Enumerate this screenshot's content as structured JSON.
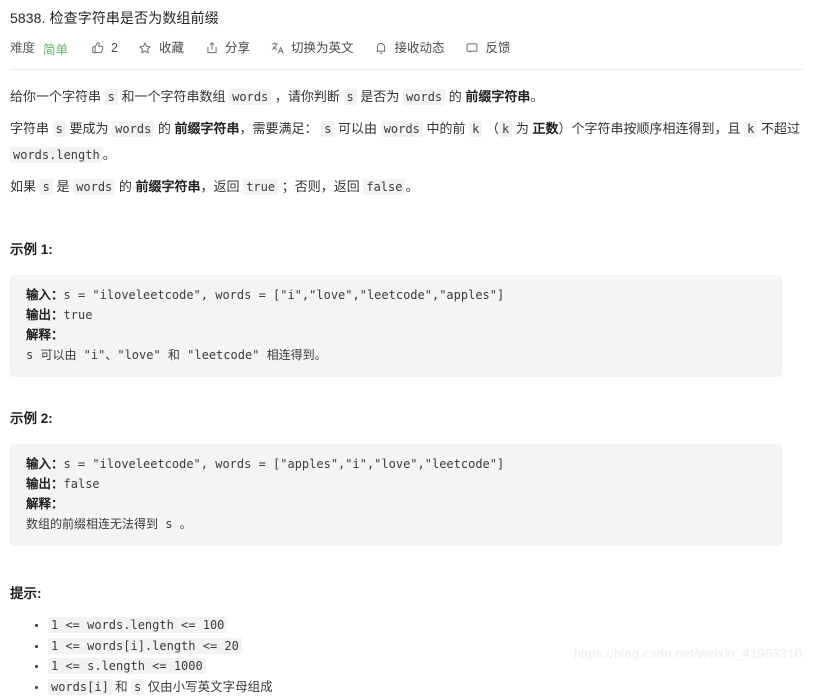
{
  "header": {
    "title": "5838. 检查字符串是否为数组前缀",
    "difficulty_label": "难度",
    "difficulty_value": "简单",
    "difficulty_color": "#5cb85c",
    "actions": [
      {
        "icon": "thumbs-up-icon",
        "label": "2"
      },
      {
        "icon": "star-icon",
        "label": "收藏"
      },
      {
        "icon": "share-icon",
        "label": "分享"
      },
      {
        "icon": "translate-icon",
        "label": "切换为英文"
      },
      {
        "icon": "bell-icon",
        "label": "接收动态"
      },
      {
        "icon": "feedback-icon",
        "label": "反馈"
      }
    ]
  },
  "description": {
    "p1": {
      "seg1": "给你一个字符串",
      "code1": "s",
      "seg2": "和一个字符串数组",
      "code2": "words",
      "seg3": "，请你判断",
      "code3": "s",
      "seg4": "是否为",
      "code4": "words",
      "seg5": "的",
      "bold1": "前缀字符串",
      "seg6": "。"
    },
    "p2": {
      "seg1": "字符串",
      "code1": "s",
      "seg2": "要成为",
      "code2": "words",
      "seg3": "的",
      "bold1": "前缀字符串",
      "seg4": "，需要满足：",
      "code3": "s",
      "seg5": "可以由",
      "code4": "words",
      "seg6": "中的前",
      "code5": "k",
      "seg7": "（",
      "code6": "k",
      "seg8": "为",
      "bold2": "正数",
      "seg9": "）个字符串按顺序相连得到，且",
      "code7": "k",
      "seg10": "不超过",
      "code8": "words.length",
      "seg11": "。"
    },
    "p3": {
      "seg1": "如果",
      "code1": "s",
      "seg2": "是",
      "code2": "words",
      "seg3": "的",
      "bold1": "前缀字符串",
      "seg4": "，返回",
      "code3": "true",
      "seg5": "；否则，返回",
      "code4": "false",
      "seg6": "。"
    }
  },
  "examples": [
    {
      "heading": "示例 1:",
      "input_label": "输入：",
      "input_value": "s = \"iloveleetcode\", words = [\"i\",\"love\",\"leetcode\",\"apples\"]",
      "output_label": "输出：",
      "output_value": "true",
      "explain_label": "解释：",
      "explain_value": "s 可以由 \"i\"、\"love\" 和 \"leetcode\" 相连得到。"
    },
    {
      "heading": "示例 2:",
      "input_label": "输入：",
      "input_value": "s = \"iloveleetcode\", words = [\"apples\",\"i\",\"love\",\"leetcode\"]",
      "output_label": "输出：",
      "output_value": "false",
      "explain_label": "解释：",
      "explain_value": "数组的前缀相连无法得到 s 。"
    }
  ],
  "hints": {
    "heading": "提示:",
    "items": [
      {
        "code": "1 <= words.length <= 100",
        "text": ""
      },
      {
        "code": "1 <= words[i].length <= 20",
        "text": ""
      },
      {
        "code": "1 <= s.length <= 1000",
        "text": ""
      },
      {
        "code": "words[i]",
        "mid": "和",
        "code2": "s",
        "text": "仅由小写英文字母组成"
      }
    ]
  },
  "watermark": "https://blog.csdn.net/weixin_41963310"
}
